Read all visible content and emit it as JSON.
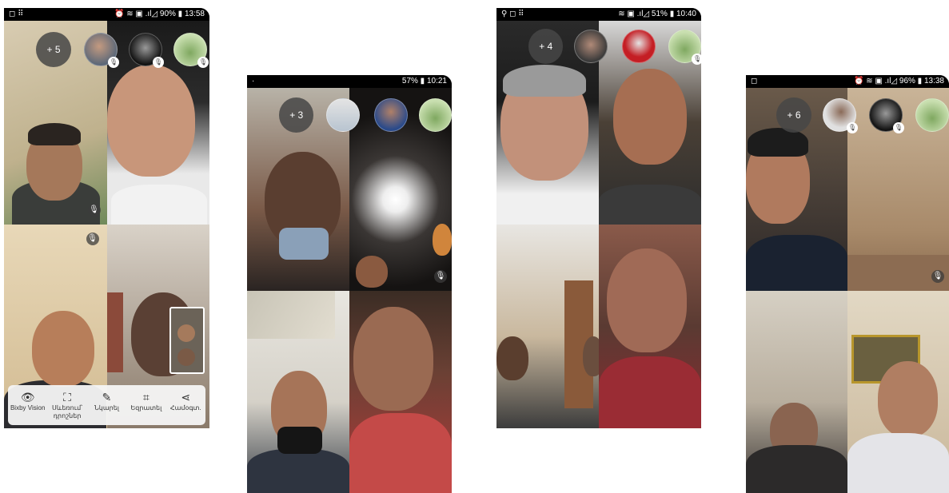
{
  "screens": [
    {
      "status_left": "◻ ⠿",
      "status_right": "⏰ ≋ ▣ .ıl◿ 90% ▮ 13:58",
      "more_label": "+ 5",
      "mute_icon": "🎙",
      "toolbar": [
        {
          "icon": "👁",
          "label": "Bixby Vision"
        },
        {
          "icon": "⛶",
          "label": "Սևեռում՝ դրոշներ"
        },
        {
          "icon": "✎",
          "label": "Նկարել"
        },
        {
          "icon": "⌗",
          "label": "Եզրատել"
        },
        {
          "icon": "⋖",
          "label": "Համօգտ."
        }
      ]
    },
    {
      "status_left": "·",
      "status_right": "57% ▮ 10:21",
      "more_label": "+ 3",
      "mute_icon": "🎙"
    },
    {
      "status_left": "⚲ ◻ ⠿",
      "status_right": "≋ ▣ .ıl◿ 51% ▮ 10:40",
      "more_label": "+ 4",
      "mute_icon": "🎙"
    },
    {
      "status_left": "◻",
      "status_right": "⏰ ≋ ▣ .ıl◿ 96% ▮ 13:38",
      "more_label": "+ 6",
      "mute_icon": "🎙"
    }
  ]
}
